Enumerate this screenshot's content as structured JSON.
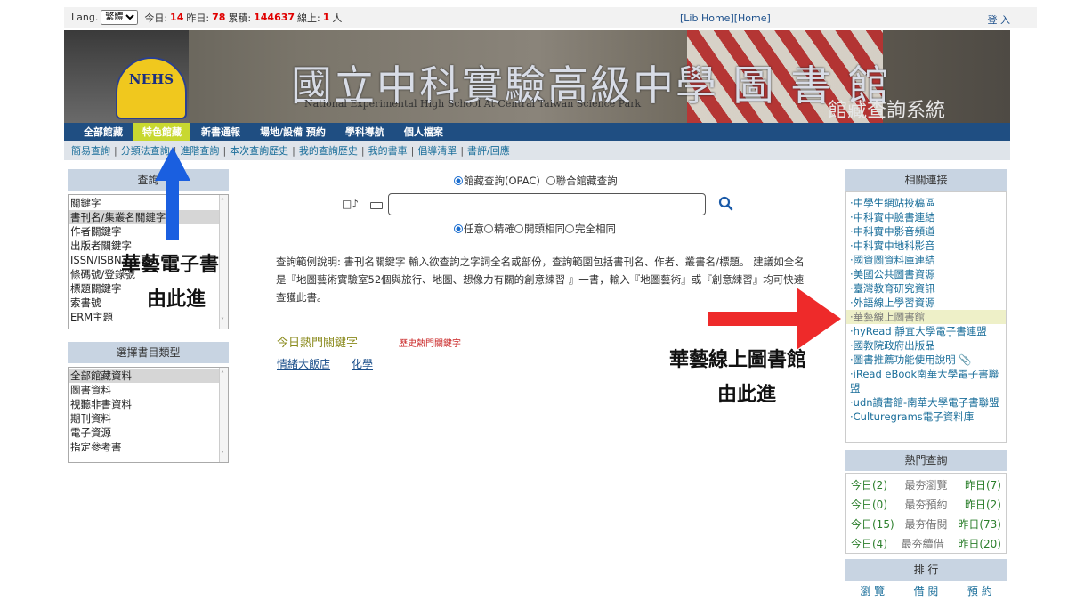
{
  "topbar": {
    "lang_label": "Lang.",
    "lang_value": "繁體",
    "today_label": "今日:",
    "today_count": "14",
    "yesterday_label": "昨日:",
    "yesterday_count": "78",
    "total_label": "累積:",
    "total_count": "144637",
    "online_label": "線上:",
    "online_count": "1",
    "online_unit": "人",
    "lib_home": "[Lib Home]",
    "home": "[Home]",
    "login": "登 入"
  },
  "banner": {
    "logo_text": "NEHS",
    "title": "國立中科實驗高級中學 圖 書 館",
    "subtitle": "National Experimental High School At Central Taiwan Science Park",
    "system_name": "館藏查詢系統"
  },
  "nav": {
    "tabs": [
      "全部館藏",
      "特色館藏",
      "新書通報",
      "場地/設備 預約",
      "學科導航",
      "個人檔案"
    ]
  },
  "subnav": {
    "items": [
      "簡易查詢",
      "分類法查詢",
      "進階查詢",
      "本次查詢歷史",
      "我的查詢歷史",
      "我的書車",
      "倡導清單",
      "書評/回應"
    ]
  },
  "left": {
    "query_header": "查詢",
    "fields": [
      "關鍵字",
      "書刊名/集叢名關鍵字",
      "作者關鍵字",
      "出版者關鍵字",
      "ISSN/ISBN",
      "條碼號/登錄號",
      "標題關鍵字",
      "索書號",
      "ERM主題"
    ],
    "type_header": "選擇書目類型",
    "types": [
      "全部館藏資料",
      "圖書資料",
      "視聽非書資料",
      "期刊資料",
      "電子資源",
      "指定參考書"
    ]
  },
  "search": {
    "mode_opac": "館藏查詢(OPAC)",
    "mode_union": "聯合館藏查詢",
    "match_any": "任意",
    "match_exact": "精確",
    "match_prefix": "開頭相同",
    "match_full": "完全相同",
    "input_value": "",
    "help_text": "查詢範例說明: 書刊名關鍵字 輸入欲查詢之字詞全名或部份，查詢範圍包括書刊名、作者、叢書名/標題。 建議如全名是『地圖藝術實驗室52個與旅行、地圖、想像力有關的創意練習 』一書，輸入『地圖藝術』或『創意練習』均可快速查獲此書。",
    "hot_title": "今日熱門關鍵字",
    "history_title": "歷史熱門關鍵字",
    "hot_keywords": [
      "情緒大飯店",
      "化學"
    ]
  },
  "related": {
    "header": "相關連接",
    "links": [
      "·中學生網站投稿區",
      "·中科實中臉書連結",
      "·中科實中影音頻道",
      "·中科實中地科影音",
      "·國資圖資料庫連結",
      "·美國公共圖書資源",
      "·臺灣教育研究資訊",
      "·外語線上學習資源",
      "·華藝線上圖書館",
      "·hyRead 靜宜大學電子書連盟",
      "·國教院政府出版品",
      "·圖書推薦功能使用說明",
      "·iRead eBook南華大學電子書聯盟",
      "·udn讀書館-南華大學電子書聯盟",
      "·Culturegrams電子資料庫"
    ]
  },
  "hot_query": {
    "header": "熱門查詢",
    "rows": [
      {
        "today": "今日(2)",
        "label": "最夯瀏覽",
        "yesterday": "昨日(7)"
      },
      {
        "today": "今日(0)",
        "label": "最夯預約",
        "yesterday": "昨日(2)"
      },
      {
        "today": "今日(15)",
        "label": "最夯借閱",
        "yesterday": "昨日(73)"
      },
      {
        "today": "今日(4)",
        "label": "最夯續借",
        "yesterday": "昨日(20)"
      }
    ]
  },
  "ranking": {
    "header": "排 行",
    "cols": [
      "瀏 覽",
      "借 閱",
      "預 約"
    ]
  },
  "annotations": {
    "left_line1": "華藝電子書",
    "left_line2": "由此進",
    "right_line1": "華藝線上圖書館",
    "right_line2": "由此進",
    "left_arrow_color": "#1a5fe0",
    "right_arrow_color": "#ee2a2a"
  }
}
